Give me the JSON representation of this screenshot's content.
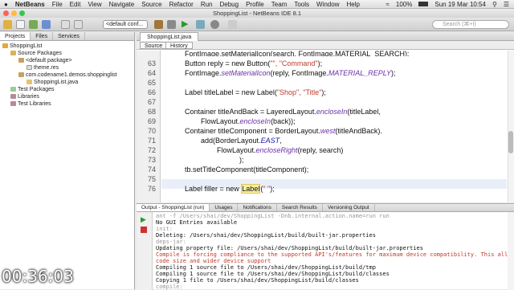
{
  "menubar": {
    "app": "NetBeans",
    "items": [
      "File",
      "Edit",
      "View",
      "Navigate",
      "Source",
      "Refactor",
      "Run",
      "Debug",
      "Profile",
      "Team",
      "Tools",
      "Window",
      "Help"
    ],
    "battery": "100%",
    "clock": "Sun 19 Mar 10:54"
  },
  "window": {
    "title": "ShoppingList - NetBeans IDE 8.1"
  },
  "toolbar": {
    "config": "<default conf...",
    "search_placeholder": "Search (⌘+I)"
  },
  "left": {
    "tabs": [
      "Projects",
      "Files",
      "Services"
    ],
    "tree": [
      {
        "label": "ShoppingList",
        "depth": 0
      },
      {
        "label": "Source Packages",
        "depth": 1
      },
      {
        "label": "<default package>",
        "depth": 2
      },
      {
        "label": "theme.res",
        "depth": 3
      },
      {
        "label": "com.codename1.demos.shoppinglist",
        "depth": 2
      },
      {
        "label": "ShoppingList.java",
        "depth": 3
      },
      {
        "label": "Test Packages",
        "depth": 1
      },
      {
        "label": "Libraries",
        "depth": 1
      },
      {
        "label": "Test Libraries",
        "depth": 1
      }
    ]
  },
  "editor": {
    "tab": "ShoppingList.java",
    "source_btn": "Source",
    "history_btn": "History",
    "line_numbers": [
      "63",
      "64",
      "65",
      "66",
      "67",
      "68",
      "69",
      "70",
      "71",
      "72",
      "73",
      "74",
      "75",
      "76"
    ],
    "lines": {
      "top": "FontImage.setMaterialIcon(search, FontImage.MATERIAL_SEARCH);",
      "l63a": "Button reply = new Button(",
      "l63s": "\"\", \"Command\"",
      "l63b": ");",
      "l64a": "FontImage.",
      "l64b": "setMaterialIcon",
      "l64c": "(reply, FontImage.",
      "l64d": "MATERIAL_REPLY",
      "l64e": ");",
      "l66a": "Label titleLabel = new Label(",
      "l66s": "\"Shop\", \"Title\"",
      "l66b": ");",
      "l68a": "Container titleAndBack = LayeredLayout.",
      "l68b": "encloseIn",
      "l68c": "(titleLabel,",
      "l69a": "FlowLayout.",
      "l69b": "encloseIn",
      "l69c": "(back));",
      "l70a": "Container titleComponent = BorderLayout.",
      "l70b": "west",
      "l70c": "(titleAndBack).",
      "l71a": "add(BorderLayout.",
      "l71b": "EAST",
      "l71c": ",",
      "l72a": "FlowLayout.",
      "l72b": "encloseRight",
      "l72c": "(reply, search)",
      "l73": ");",
      "l74": "tb.setTitleComponent(titleComponent);",
      "l76a": "Label filler = new ",
      "l76b": "Label",
      "l76c": "(",
      "l76s": "\" \"",
      "l76d": ");"
    }
  },
  "output": {
    "tabs": [
      "Output - ShoppingList (run)",
      "Usages",
      "Notifications",
      "Search Results",
      "Versioning Output"
    ],
    "lines": [
      {
        "t": "ant -f /Users/shai/dev/ShoppingList -Dnb.internal.action.name=run run",
        "c": "grey"
      },
      {
        "t": "No GUI Entries available",
        "c": ""
      },
      {
        "t": "init:",
        "c": "grey"
      },
      {
        "t": "Deleting: /Users/shai/dev/ShoppingList/build/built-jar.properties",
        "c": ""
      },
      {
        "t": "deps-jar:",
        "c": "grey"
      },
      {
        "t": "Updating property file: /Users/shai/dev/ShoppingList/build/built-jar.properties",
        "c": ""
      },
      {
        "t": "Compile is forcing compliance to the supported API's/features for maximum device compatibility. This allows sm",
        "c": "red"
      },
      {
        "t": "        code size and wider device support",
        "c": "red"
      },
      {
        "t": "Compiling 1 source file to /Users/shai/dev/ShoppingList/build/tmp",
        "c": ""
      },
      {
        "t": "Compiling 1 source file to /Users/shai/dev/ShoppingList/build/classes",
        "c": ""
      },
      {
        "t": "Copying 1 file to /Users/shai/dev/ShoppingList/build/classes",
        "c": ""
      },
      {
        "t": "compile:",
        "c": "grey"
      }
    ]
  },
  "video": {
    "timestamp": "00:36:03"
  },
  "colors": {
    "accent": "#3d7bd9",
    "keyword": "#1a1aa6",
    "italic": "#6b2fa8",
    "string": "#c0392b"
  }
}
